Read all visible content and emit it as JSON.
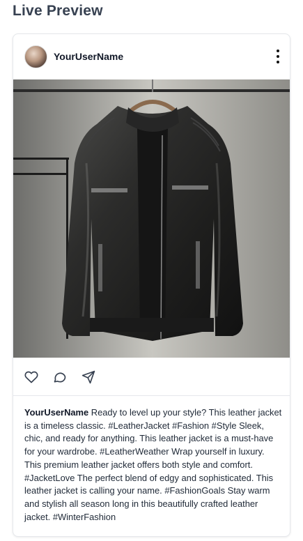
{
  "section": {
    "title": "Live Preview"
  },
  "post": {
    "username": "YourUserName",
    "image_alt": "Black leather jacket on a hanger",
    "caption": "Ready to level up your style? This leather jacket is a timeless classic. #LeatherJacket #Fashion #Style Sleek, chic, and ready for anything. This leather jacket is a must-have for your wardrobe. #LeatherWeather Wrap yourself in luxury. This premium leather jacket offers both style and comfort. #JacketLove The perfect blend of edgy and sophisticated. This leather jacket is calling your name. #FashionGoals Stay warm and stylish all season long in this beautifully crafted leather jacket. #WinterFashion"
  },
  "icons": {
    "more": "more-vertical-icon",
    "like": "heart-icon",
    "comment": "comment-icon",
    "share": "send-icon"
  }
}
